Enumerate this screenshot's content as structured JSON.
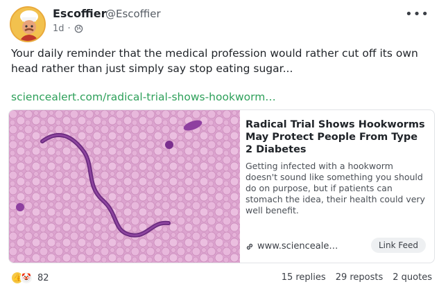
{
  "post": {
    "author_name": "Escoffier",
    "author_handle": "@Escoffier",
    "time": "1d",
    "separator": "·",
    "visibility_icon": "globe-icon",
    "more_icon": "more-dots-icon",
    "more_label": "•••",
    "text": "Your daily reminder that the medical profession would rather cut off its own head rather than just simply say stop eating sugar...",
    "link_text": "sciencealert.com/radical-trial-shows-hookworm…"
  },
  "card": {
    "title": "Radical Trial Shows Hookworms May Protect People From Type 2 Diabetes",
    "description": "Getting infected with a hookworm doesn't sound like something you should do on purpose, but if patients can stomach the idea, their health could very well benefit.",
    "url": "www.scienceale…",
    "url_icon": "link-icon",
    "link_feed_label": "Link Feed"
  },
  "footer": {
    "reaction_icons": [
      "thumbs-up-icon",
      "clown-icon"
    ],
    "reaction_count": "82",
    "replies": "15 replies",
    "reposts": "29 reposts",
    "quotes": "2 quotes"
  },
  "colors": {
    "link": "#2ea05a",
    "muted": "#6b7078"
  }
}
